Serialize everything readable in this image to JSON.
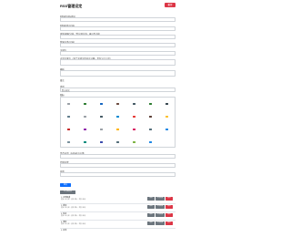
{
  "header": {
    "title": "RSS管理设定",
    "danger_button": "重置"
  },
  "form": {
    "feed_url_label": "RSS的URL地址",
    "feed_name_label": "RSS名称(可选)",
    "interval_label": "更新间隔(分钟，默认30分钟，最少5分钟)",
    "category_label": "所属分类(可选)",
    "keyword_label": "关键字",
    "filter_label": "过滤关键字（多个关键字用逗号分隔，不区分大小写）",
    "template_label": "模板",
    "template_value": "",
    "notes_label": "备注",
    "notes_value": "",
    "type_label": "类型",
    "type_value": "默认模式",
    "icon_label": "图标",
    "extra_label_1": "是否启用（勾选表示启用）",
    "extra_value_1": "",
    "extra_label_2": "代理设置",
    "extra_value_2": "",
    "extra_label_3": "其他",
    "extra_value_3": "",
    "submit_label": "提交",
    "list_button": "已订阅列表"
  },
  "icons": [
    {
      "name": "dot-icon",
      "color": "#9aa0a6"
    },
    {
      "name": "flag-icon",
      "color": "#2e7d32"
    },
    {
      "name": "user-icon",
      "color": "#1565c0"
    },
    {
      "name": "mail-icon",
      "color": "#6d4c41"
    },
    {
      "name": "bell-icon",
      "color": "#455a64"
    },
    {
      "name": "leaf-icon",
      "color": "#2e7d32"
    },
    {
      "name": "cloud-icon",
      "color": "#37474f"
    },
    {
      "name": "arrow-icon",
      "color": "#607d8b"
    },
    {
      "name": "dot-icon",
      "color": "#9aa0a6"
    },
    {
      "name": "check-icon",
      "color": "#455a64"
    },
    {
      "name": "calendar-icon",
      "color": "#0288d1"
    },
    {
      "name": "home-icon",
      "color": "#e53935"
    },
    {
      "name": "book-icon",
      "color": "#5d4037"
    },
    {
      "name": "star-icon",
      "color": "#fbc02d"
    },
    {
      "name": "gift-icon",
      "color": "#c62828"
    },
    {
      "name": "chat-icon",
      "color": "#8e24aa"
    },
    {
      "name": "pin-icon",
      "color": "#9aa0a6"
    },
    {
      "name": "pen-icon",
      "color": "#ffb300"
    },
    {
      "name": "heart-icon",
      "color": "#d81b60"
    },
    {
      "name": "camera-icon",
      "color": "#546e7a"
    },
    {
      "name": "music-icon",
      "color": "#1e88e5"
    },
    {
      "name": "clip-icon",
      "color": "#78909c"
    },
    {
      "name": "tag-icon",
      "color": "#00897b"
    },
    {
      "name": "cart-icon",
      "color": "#3949ab"
    },
    {
      "name": "globe-icon",
      "color": "#546e7a"
    },
    {
      "name": "map-icon",
      "color": "#7cb342"
    },
    {
      "name": "fire-icon",
      "color": "#1e88e5"
    }
  ],
  "subscriptions": [
    {
      "name": "1. 示例频道",
      "detail": "更新: 30 分钟 · 分类: 默认 · 状态: 启用",
      "edit": "编辑",
      "refresh": "立即刷新",
      "delete": "删除"
    },
    {
      "name": "2. 新闻",
      "detail": "更新: 30 分钟 · 分类: 默认 · 状态: 启用",
      "edit": "编辑",
      "refresh": "立即刷新",
      "delete": "删除"
    },
    {
      "name": "3. 科技",
      "detail": "更新: 30 分钟 · 分类: 默认 · 状态: 启用",
      "edit": "编辑",
      "refresh": "立即刷新",
      "delete": "删除"
    },
    {
      "name": "4. 博客",
      "detail": "更新: 30 分钟 · 分类: 默认 · 状态: 启用",
      "edit": "编辑",
      "refresh": "立即刷新",
      "delete": "删除"
    },
    {
      "name": "5. 其他",
      "detail": "",
      "edit": "",
      "refresh": "",
      "delete": ""
    }
  ]
}
